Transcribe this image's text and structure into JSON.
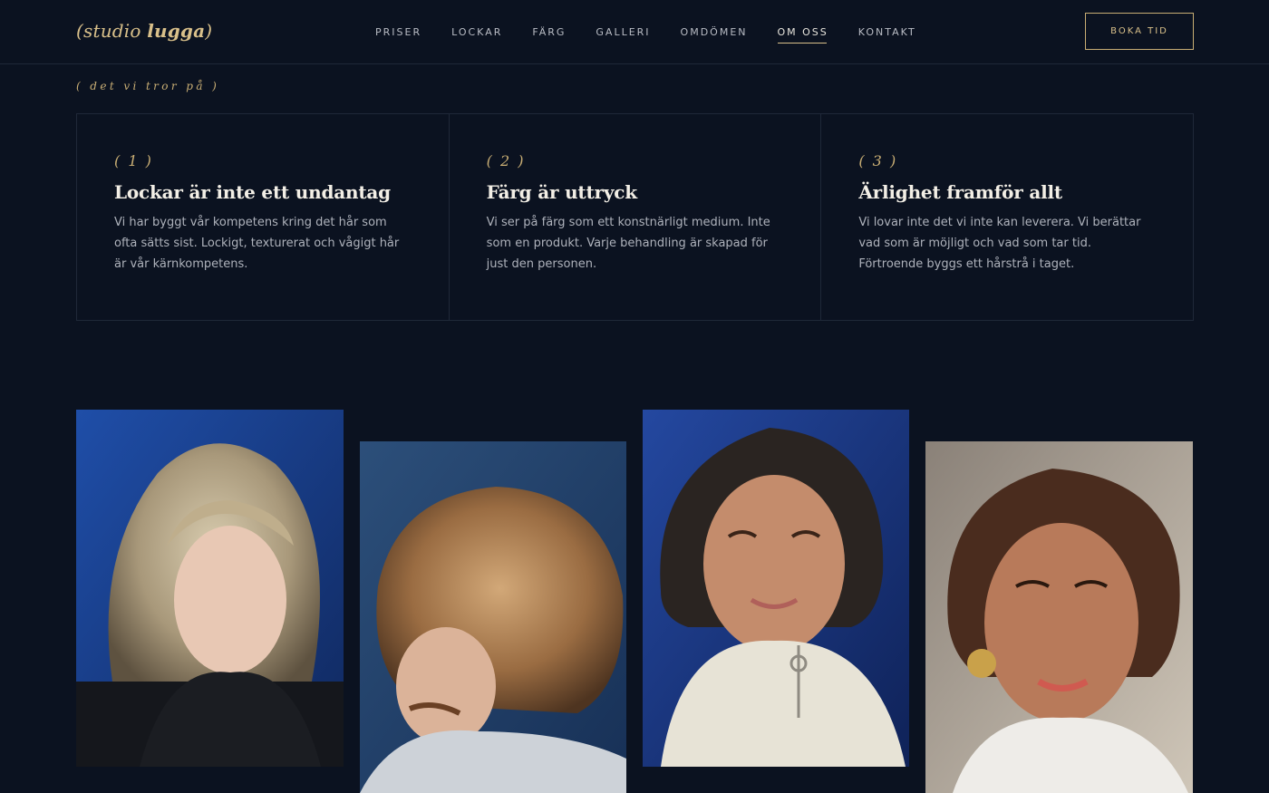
{
  "brand": {
    "logo_prefix": "(studio ",
    "logo_bold": "lugga",
    "logo_suffix": ")"
  },
  "nav": {
    "items": [
      {
        "label": "PRISER"
      },
      {
        "label": "LOCKAR"
      },
      {
        "label": "FÄRG"
      },
      {
        "label": "GALLERI"
      },
      {
        "label": "OMDÖMEN"
      },
      {
        "label": "OM OSS",
        "active": true
      },
      {
        "label": "KONTAKT"
      }
    ],
    "cta_label": "BOKA TID"
  },
  "values_section": {
    "label": "( det vi tror på )",
    "cards": [
      {
        "number": "( 1 )",
        "title": "Lockar är inte ett undantag",
        "text": "Vi har byggt vår kompetens kring det hår som ofta sätts sist. Lockigt, texturerat och vågigt hår är vår kärnkompetens."
      },
      {
        "number": "( 2 )",
        "title": "Färg är uttryck",
        "text": "Vi ser på färg som ett konstnärligt medium. Inte som en produkt. Varje behandling är skapad för just den personen."
      },
      {
        "number": "( 3 )",
        "title": "Ärlighet framför allt",
        "text": "Vi lovar inte det vi inte kan leverera. Vi berättar vad som är möjligt och vad som tar tid. Förtroende byggs ett hårstrå i taget."
      }
    ]
  },
  "colors": {
    "background": "#0b1220",
    "accent_gold": "#c9ae74",
    "text_light": "#f3efe6",
    "text_muted": "#aeb2bb"
  }
}
